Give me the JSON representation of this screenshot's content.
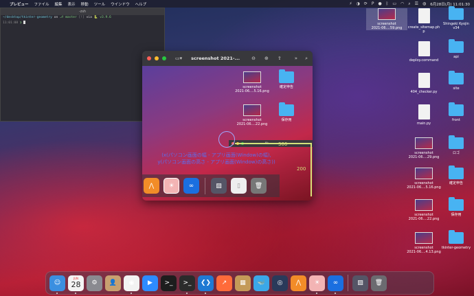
{
  "menubar": {
    "app_name": "プレビュー",
    "menus": [
      "ファイル",
      "編集",
      "表示",
      "移動",
      "ツール",
      "ウインドウ",
      "ヘルプ"
    ],
    "clock": "6月28日(月) 11:01:30"
  },
  "terminal": {
    "title": "-zsh",
    "prompt_path": "~/desktop/tkinter-geometry",
    "prompt_on": "on",
    "branch": "master",
    "branch_status": "[!]",
    "via": "via",
    "version": "v3.9.6",
    "time": "11:01:08",
    "prompt_symbol": "❯"
  },
  "preview": {
    "title": "screenshot 2021-...",
    "inner_tk_title": "tk",
    "inner_icons": [
      {
        "label": "screenshot\n2021-06....5.16.png",
        "kind": "shot"
      },
      {
        "label": "確定申告",
        "kind": "folder"
      },
      {
        "label": "screenshot\n2021-06....22.png",
        "kind": "shot"
      },
      {
        "label": "保存用",
        "kind": "folder"
      }
    ]
  },
  "annotation": {
    "line1": "(x(パソコン画面の幅 - アプリ画面(Window)の幅),",
    "line2": "y(パソコン画面の高さ - アプリ画面(Window)の高さ))",
    "width_value": "300",
    "height_value": "200",
    "color": "#5b6ef0"
  },
  "desktop_icons": [
    {
      "label": "screenshot\n2021-06....59.png",
      "kind": "shot"
    },
    {
      "label": "create_sitemap.ph\np",
      "kind": "doc"
    },
    {
      "label": "Shingeki Kyojin\nv34",
      "kind": "folder"
    },
    {
      "label": "deploy.command",
      "kind": "doc"
    },
    {
      "label": "api",
      "kind": "folder"
    },
    {
      "label": "404_checker.py",
      "kind": "doc"
    },
    {
      "label": "site",
      "kind": "folder"
    },
    {
      "label": "main.py",
      "kind": "doc"
    },
    {
      "label": "front",
      "kind": "folder"
    },
    {
      "label": "screenshot\n2021-06....29.png",
      "kind": "shot"
    },
    {
      "label": "ロゴ",
      "kind": "folder"
    },
    {
      "label": "screenshot\n2021-06....5.16.png",
      "kind": "shot"
    },
    {
      "label": "確定申告",
      "kind": "folder"
    },
    {
      "label": "screenshot\n2021-06....22.png",
      "kind": "shot"
    },
    {
      "label": "保存用",
      "kind": "folder"
    },
    {
      "label": "screenshot\n2021-06....4.13.png",
      "kind": "shot"
    },
    {
      "label": "tkinter-geometry",
      "kind": "folder"
    }
  ],
  "calendar": {
    "month": "JUN",
    "day": "28"
  },
  "dock_apps": [
    {
      "name": "finder-icon",
      "color": "#3b8fe0",
      "glyph": "☺"
    },
    {
      "name": "calendar-icon",
      "color": "#f4f4f4",
      "glyph": ""
    },
    {
      "name": "system-preferences-icon",
      "color": "#8a8a90",
      "glyph": "⚙"
    },
    {
      "name": "contacts-icon",
      "color": "#c8a070",
      "glyph": "👤"
    },
    {
      "name": "chrome-icon",
      "color": "#f2f2f2",
      "glyph": "◉"
    },
    {
      "name": "zoom-icon",
      "color": "#2d8cff",
      "glyph": "▶"
    },
    {
      "name": "terminal-dark-icon",
      "color": "#1d1d1d",
      "glyph": ">_"
    },
    {
      "name": "terminal-icon",
      "color": "#2b2b2b",
      "glyph": ">_"
    },
    {
      "name": "vscode-icon",
      "color": "#1f7ad3",
      "glyph": "❮❯"
    },
    {
      "name": "activity-monitor-icon",
      "color": "#ff6b3a",
      "glyph": "↗"
    },
    {
      "name": "archive-utility-icon",
      "color": "#c49a58",
      "glyph": "▦"
    },
    {
      "name": "docker-icon",
      "color": "#3ba8e8",
      "glyph": "🐳"
    },
    {
      "name": "screenshot-app-icon",
      "color": "#2a3a5a",
      "glyph": "◎"
    },
    {
      "name": "sourcetree-icon",
      "color": "#f28c28",
      "glyph": "⋀"
    },
    {
      "name": "preview-icon",
      "color": "#f3b4b4",
      "glyph": "☀"
    },
    {
      "name": "infinity-icon",
      "color": "#1a6fe0",
      "glyph": "∞"
    }
  ]
}
